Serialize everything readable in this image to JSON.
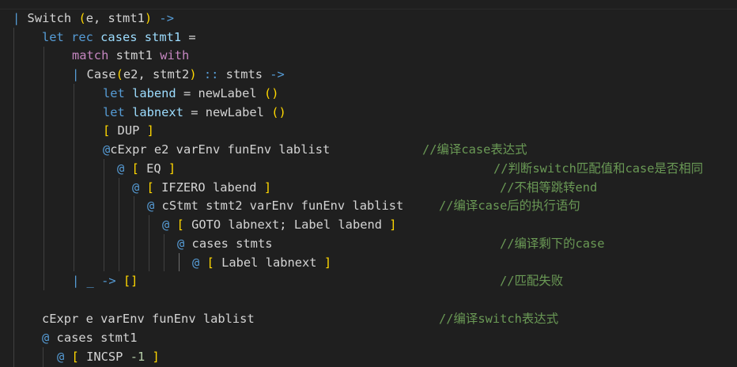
{
  "colors": {
    "background": "#1f1f1f",
    "keyword": "#569cd6",
    "control_keyword": "#c586c0",
    "identifier": "#9cdcfe",
    "function": "#dcdcaa",
    "type": "#4ec9b0",
    "bracket": "#ffd700",
    "paren_inner": "#da70d6",
    "operator": "#d4d4d4",
    "at_operator": "#569cd6",
    "number": "#b5cea8",
    "comment": "#6a9955",
    "text": "#d4d4d4"
  },
  "code_lines": [
    {
      "tokens": [
        {
          "text": "| ",
          "c": "keyword"
        },
        {
          "text": "Switch",
          "c": "text"
        },
        {
          "text": " ",
          "c": "text"
        },
        {
          "text": "(",
          "c": "bracket"
        },
        {
          "text": "e, stmt1",
          "c": "text"
        },
        {
          "text": ")",
          "c": "bracket"
        },
        {
          "text": " ",
          "c": "text"
        },
        {
          "text": "->",
          "c": "keyword"
        }
      ]
    },
    {
      "tokens": [
        {
          "text": "let",
          "c": "keyword"
        },
        {
          "text": " rec ",
          "c": "keyword"
        },
        {
          "text": "cases",
          "c": "identifier"
        },
        {
          "text": " ",
          "c": "text"
        },
        {
          "text": "stmt1",
          "c": "identifier"
        },
        {
          "text": " =",
          "c": "text"
        }
      ]
    },
    {
      "tokens": [
        {
          "text": "match",
          "c": "control_keyword"
        },
        {
          "text": " stmt1 ",
          "c": "text"
        },
        {
          "text": "with",
          "c": "control_keyword"
        }
      ]
    },
    {
      "tokens": [
        {
          "text": "| ",
          "c": "keyword"
        },
        {
          "text": "Case",
          "c": "text"
        },
        {
          "text": "(",
          "c": "bracket"
        },
        {
          "text": "e2, stmt2",
          "c": "text"
        },
        {
          "text": ")",
          "c": "bracket"
        },
        {
          "text": " :: ",
          "c": "keyword"
        },
        {
          "text": "stmts",
          "c": "text"
        },
        {
          "text": " ->",
          "c": "keyword"
        }
      ]
    },
    {
      "tokens": [
        {
          "text": "let",
          "c": "keyword"
        },
        {
          "text": " ",
          "c": "text"
        },
        {
          "text": "labend",
          "c": "identifier"
        },
        {
          "text": " = ",
          "c": "text"
        },
        {
          "text": "newLabel",
          "c": "text"
        },
        {
          "text": " ",
          "c": "text"
        },
        {
          "text": "()",
          "c": "bracket"
        }
      ]
    },
    {
      "tokens": [
        {
          "text": "let",
          "c": "keyword"
        },
        {
          "text": " ",
          "c": "text"
        },
        {
          "text": "labnext",
          "c": "identifier"
        },
        {
          "text": " = ",
          "c": "text"
        },
        {
          "text": "newLabel",
          "c": "text"
        },
        {
          "text": " ",
          "c": "text"
        },
        {
          "text": "()",
          "c": "bracket"
        }
      ]
    },
    {
      "tokens": [
        {
          "text": "[",
          "c": "bracket"
        },
        {
          "text": " DUP ",
          "c": "text"
        },
        {
          "text": "]",
          "c": "bracket"
        }
      ]
    },
    {
      "tokens": [
        {
          "text": "@",
          "c": "at_operator"
        },
        {
          "text": "cExpr e2 varEnv funEnv lablist",
          "c": "text"
        }
      ],
      "comment": "//编译case表达式"
    },
    {
      "tokens": [
        {
          "text": "@ ",
          "c": "at_operator"
        },
        {
          "text": "[",
          "c": "bracket"
        },
        {
          "text": " EQ ",
          "c": "text"
        },
        {
          "text": "]",
          "c": "bracket"
        }
      ],
      "comment": "//判断switch匹配值和case是否相同"
    },
    {
      "tokens": [
        {
          "text": "@ ",
          "c": "at_operator"
        },
        {
          "text": "[",
          "c": "bracket"
        },
        {
          "text": " IFZERO labend ",
          "c": "text"
        },
        {
          "text": "]",
          "c": "bracket"
        }
      ],
      "comment": "//不相等跳转end"
    },
    {
      "tokens": [
        {
          "text": "@ ",
          "c": "at_operator"
        },
        {
          "text": "cStmt stmt2 varEnv funEnv lablist",
          "c": "text"
        }
      ],
      "comment": "//编译case后的执行语句"
    },
    {
      "tokens": [
        {
          "text": "@ ",
          "c": "at_operator"
        },
        {
          "text": "[",
          "c": "bracket"
        },
        {
          "text": " GOTO labnext; Label labend ",
          "c": "text"
        },
        {
          "text": "]",
          "c": "bracket"
        }
      ]
    },
    {
      "tokens": [
        {
          "text": "@ ",
          "c": "at_operator"
        },
        {
          "text": "cases stmts",
          "c": "text"
        }
      ],
      "comment": "//编译剩下的case"
    },
    {
      "tokens": [
        {
          "text": "@ ",
          "c": "at_operator"
        },
        {
          "text": "[",
          "c": "bracket"
        },
        {
          "text": " Label labnext ",
          "c": "text"
        },
        {
          "text": "]",
          "c": "bracket"
        }
      ]
    },
    {
      "tokens": [
        {
          "text": "| ",
          "c": "keyword"
        },
        {
          "text": "_",
          "c": "keyword"
        },
        {
          "text": " -> ",
          "c": "keyword"
        },
        {
          "text": "[]",
          "c": "bracket"
        }
      ],
      "comment": "//匹配失败"
    },
    {
      "tokens": []
    },
    {
      "tokens": [
        {
          "text": "cExpr e varEnv funEnv lablist",
          "c": "text"
        }
      ],
      "comment": "//编译switch表达式"
    },
    {
      "tokens": [
        {
          "text": "@ ",
          "c": "at_operator"
        },
        {
          "text": "cases stmt1",
          "c": "text"
        }
      ]
    },
    {
      "tokens": [
        {
          "text": "@ ",
          "c": "at_operator"
        },
        {
          "text": "[",
          "c": "bracket"
        },
        {
          "text": " INCSP ",
          "c": "text"
        },
        {
          "text": "-1",
          "c": "number"
        },
        {
          "text": " ",
          "c": "text"
        },
        {
          "text": "]",
          "c": "bracket"
        }
      ]
    }
  ]
}
